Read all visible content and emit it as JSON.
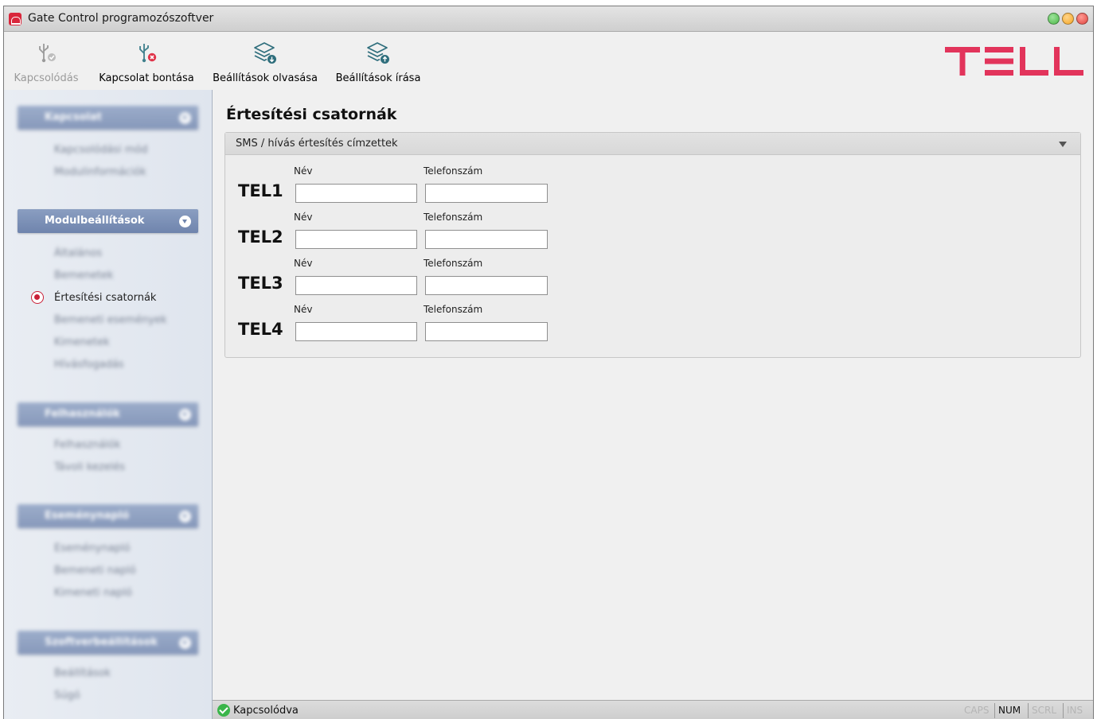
{
  "window": {
    "title": "Gate Control programozószoftver",
    "controls": [
      {
        "name": "minimize",
        "color": "#4cb848"
      },
      {
        "name": "maximize",
        "color": "#f5a623"
      },
      {
        "name": "close",
        "color": "#e0443e"
      }
    ]
  },
  "toolbar": {
    "connect_label": "Kapcsolódás",
    "disconnect_label": "Kapcsolat bontása",
    "read_settings_label": "Beállítások olvasása",
    "write_settings_label": "Beállítások írása",
    "logo_color": "#e2345b"
  },
  "sidebar": {
    "groups": [
      {
        "label": "Kapcsolat",
        "blurred": true
      },
      {
        "label": "Modulbeállítások",
        "blurred": false
      },
      {
        "label": "Felhasználók",
        "blurred": true
      },
      {
        "label": "Eseménynapló",
        "blurred": true
      },
      {
        "label": "Szoftverbeállítások",
        "blurred": true
      }
    ],
    "items": [
      {
        "label": "Kapcsolódási mód",
        "blurred": true
      },
      {
        "label": "Modulinformációk",
        "blurred": true
      },
      {
        "label": "Általános",
        "blurred": true
      },
      {
        "label": "Bemenetek",
        "blurred": true
      },
      {
        "label": "Értesítési csatornák",
        "blurred": false,
        "selected": true
      },
      {
        "label": "Bemeneti események",
        "blurred": true
      },
      {
        "label": "Kimenetek",
        "blurred": true
      },
      {
        "label": "Hívásfogadás",
        "blurred": true
      },
      {
        "label": "Felhasználók",
        "blurred": true
      },
      {
        "label": "Távoli kezelés",
        "blurred": true
      },
      {
        "label": "Eseménynapló",
        "blurred": true
      },
      {
        "label": "Bemeneti napló",
        "blurred": true
      },
      {
        "label": "Kimeneti napló",
        "blurred": true
      },
      {
        "label": "Beállítások",
        "blurred": true
      },
      {
        "label": "Súgó",
        "blurred": true
      }
    ],
    "accent_color": "#c91f37"
  },
  "main": {
    "page_title": "Értesítési csatornák",
    "panel": {
      "title": "SMS / hívás értesítés címzettek",
      "rows": [
        {
          "tel": "TEL1",
          "name_label": "Név",
          "phone_label": "Telefonszám",
          "name_value": "",
          "phone_value": ""
        },
        {
          "tel": "TEL2",
          "name_label": "Név",
          "phone_label": "Telefonszám",
          "name_value": "",
          "phone_value": ""
        },
        {
          "tel": "TEL3",
          "name_label": "Név",
          "phone_label": "Telefonszám",
          "name_value": "",
          "phone_value": ""
        },
        {
          "tel": "TEL4",
          "name_label": "Név",
          "phone_label": "Telefonszám",
          "name_value": "",
          "phone_value": ""
        }
      ]
    }
  },
  "statusbar": {
    "status": "Kapcsolódva",
    "indicators": [
      {
        "label": "CAPS",
        "active": false
      },
      {
        "label": "NUM",
        "active": true
      },
      {
        "label": "SCRL",
        "active": false
      },
      {
        "label": "INS",
        "active": false
      }
    ]
  }
}
